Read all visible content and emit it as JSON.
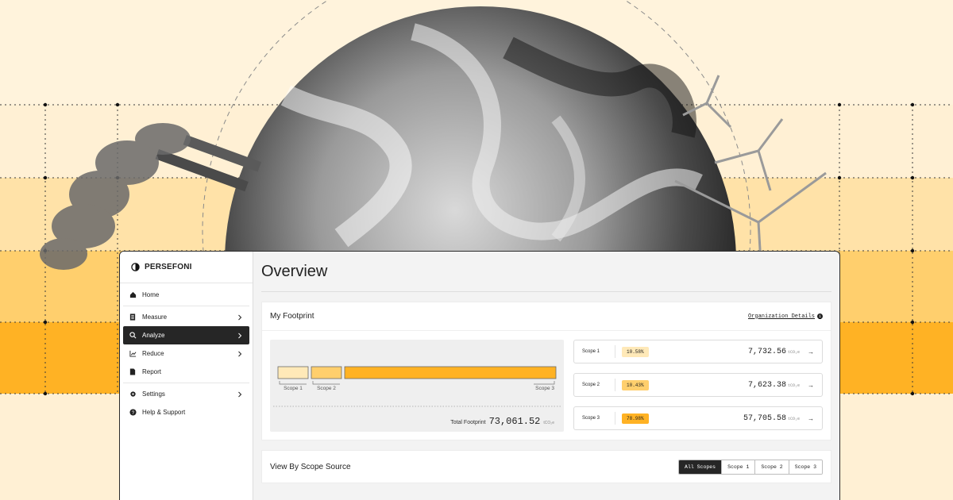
{
  "colors": {
    "accent": "#ffb224",
    "scope1": "#ffe9b8",
    "scope2": "#ffcf6d",
    "scope3": "#ffb224",
    "dark": "#262626"
  },
  "brand": {
    "name": "PERSEFONI",
    "logo_icon": "persefoni-logo-icon"
  },
  "sidebar": {
    "items": [
      {
        "label": "Home",
        "icon": "home-icon",
        "chevron": false,
        "active": false
      },
      {
        "label": "Measure",
        "icon": "document-icon",
        "chevron": true,
        "active": false
      },
      {
        "label": "Analyze",
        "icon": "magnifier-icon",
        "chevron": true,
        "active": true
      },
      {
        "label": "Reduce",
        "icon": "chart-icon",
        "chevron": true,
        "active": false
      },
      {
        "label": "Report",
        "icon": "report-icon",
        "chevron": false,
        "active": false
      },
      {
        "label": "Settings",
        "icon": "gear-icon",
        "chevron": true,
        "active": false
      },
      {
        "label": "Help & Support",
        "icon": "help-icon",
        "chevron": false,
        "active": false
      }
    ]
  },
  "main": {
    "title": "Overview",
    "footprint": {
      "title": "My Footprint",
      "org_link": "Organization Details",
      "total_label": "Total Footprint",
      "total_value": "73,061.52",
      "unit": "tCO₂e",
      "bar_labels": [
        "Scope 1",
        "Scope 2",
        "Scope 3"
      ],
      "scopes": [
        {
          "name": "Scope 1",
          "pct": "10.58%",
          "value": "7,732.56",
          "share": 10.58
        },
        {
          "name": "Scope 2",
          "pct": "10.43%",
          "value": "7,623.38",
          "share": 10.43
        },
        {
          "name": "Scope 3",
          "pct": "78.98%",
          "value": "57,705.58",
          "share": 78.98
        }
      ]
    },
    "view_by": {
      "title": "View By Scope Source",
      "tabs": [
        "All Scopes",
        "Scope 1",
        "Scope 2",
        "Scope 3"
      ],
      "active_tab": 0
    }
  }
}
